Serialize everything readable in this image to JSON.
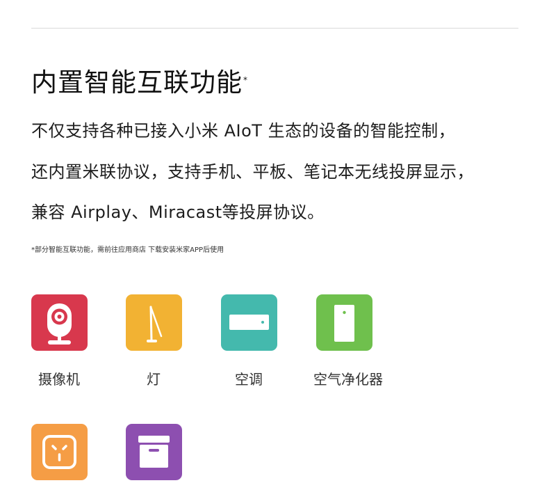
{
  "title": "内置智能互联功能",
  "title_mark": "*",
  "description": [
    "不仅支持各种已接入小米 AIoT 生态的设备的智能控制，",
    "还内置米联协议，支持手机、平板、笔记本无线投屏显示，",
    "兼容 Airplay、Miracast等投屏协议。"
  ],
  "footnote": "*部分智能互联功能，需前往应用商店 下载安装米家APP后使用",
  "devices": [
    {
      "label": "摄像机",
      "icon": "camera-icon",
      "color": "#d8384d"
    },
    {
      "label": "灯",
      "icon": "lamp-icon",
      "color": "#f2b233"
    },
    {
      "label": "空调",
      "icon": "air-conditioner-icon",
      "color": "#44b9ad"
    },
    {
      "label": "空气净化器",
      "icon": "air-purifier-icon",
      "color": "#6fc04d"
    },
    {
      "label": "",
      "icon": "smart-socket-icon",
      "color": "#f59d45"
    },
    {
      "label": "",
      "icon": "storage-box-icon",
      "color": "#8d4fb0"
    }
  ]
}
